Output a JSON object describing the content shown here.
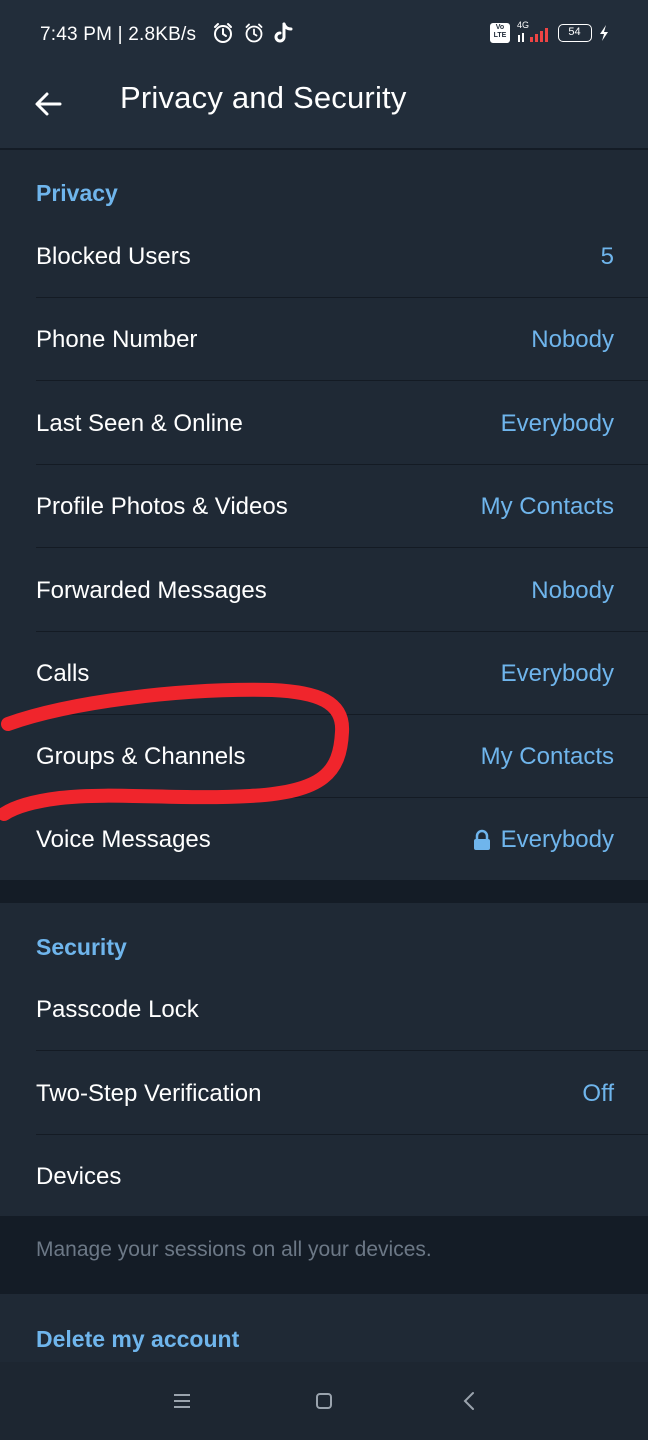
{
  "status_bar": {
    "time": "7:43 PM | 2.8KB/s",
    "network_type": "4G",
    "volte": "Vo LTE",
    "battery": "54"
  },
  "header": {
    "title": "Privacy and Security"
  },
  "privacy": {
    "header": "Privacy",
    "items": [
      {
        "label": "Blocked Users",
        "value": "5"
      },
      {
        "label": "Phone Number",
        "value": "Nobody"
      },
      {
        "label": "Last Seen & Online",
        "value": "Everybody"
      },
      {
        "label": "Profile Photos & Videos",
        "value": "My Contacts"
      },
      {
        "label": "Forwarded Messages",
        "value": "Nobody"
      },
      {
        "label": "Calls",
        "value": "Everybody"
      },
      {
        "label": "Groups & Channels",
        "value": "My Contacts"
      },
      {
        "label": "Voice Messages",
        "value": "Everybody",
        "locked": true
      }
    ]
  },
  "security": {
    "header": "Security",
    "items": [
      {
        "label": "Passcode Lock",
        "value": ""
      },
      {
        "label": "Two-Step Verification",
        "value": "Off"
      },
      {
        "label": "Devices",
        "value": ""
      }
    ],
    "hint": "Manage your sessions on all your devices."
  },
  "delete_account": {
    "header": "Delete my account"
  },
  "colors": {
    "background": "#141c26",
    "surface": "#1f2935",
    "accent": "#6fb5ec",
    "annotation": "#f0252c"
  },
  "icons": {
    "back": "arrow-left-icon",
    "alarm": "alarm-icon",
    "tiktok": "tiktok-icon",
    "lock": "lock-icon",
    "menu": "menu-icon",
    "home": "square-icon",
    "nav_back": "chevron-left-icon"
  }
}
